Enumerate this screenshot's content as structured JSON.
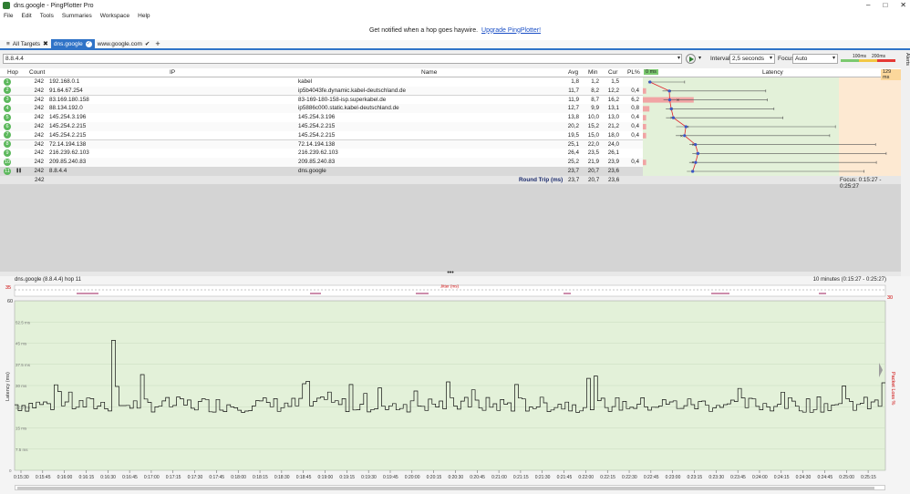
{
  "window": {
    "title": "dns.google - PingPlotter Pro"
  },
  "menu": [
    "File",
    "Edit",
    "Tools",
    "Summaries",
    "Workspace",
    "Help"
  ],
  "notice": {
    "text": "Get notified when a hop goes haywire.",
    "link": "Upgrade PingPlotter!"
  },
  "tabs": [
    {
      "label": "All Targets",
      "active": false
    },
    {
      "label": "dns.google",
      "active": true
    },
    {
      "label": "www.google.com",
      "active": false
    }
  ],
  "toolbar": {
    "address": "8.8.4.4",
    "interval_label": "Interval",
    "interval_value": "2,5 seconds",
    "focus_label": "Focus",
    "focus_value": "Auto",
    "scale_100": "100ms",
    "scale_200": "200ms",
    "alerts_label": "Alerts"
  },
  "columns": {
    "hop": "Hop",
    "count": "Count",
    "ip": "IP",
    "name": "Name",
    "avg": "Avg",
    "min": "Min",
    "cur": "Cur",
    "pl": "PL%",
    "latency": "Latency",
    "lat_min": "0 ms",
    "lat_max": "129 ms"
  },
  "hops": [
    {
      "hop": "1",
      "count": "242",
      "ip": "192.168.0.1",
      "name": "kabel",
      "avg": "1,8",
      "min": "1,2",
      "cur": "1,5",
      "pl": "",
      "pl_value": 0
    },
    {
      "hop": "2",
      "count": "242",
      "ip": "91.64.67.254",
      "name": "ip5b4043fe.dynamic.kabel-deutschland.de",
      "avg": "11,7",
      "min": "8,2",
      "cur": "12,2",
      "pl": "0,4",
      "pl_value": 0.4
    },
    {
      "hop": "3",
      "count": "242",
      "ip": "83.169.180.158",
      "name": "83-169-180-158-isp.superkabel.de",
      "avg": "11,9",
      "min": "8,7",
      "cur": "16,2",
      "pl": "6,2",
      "pl_value": 6.2
    },
    {
      "hop": "4",
      "count": "242",
      "ip": "88.134.192.0",
      "name": "ip5886c000.static.kabel-deutschland.de",
      "avg": "12,7",
      "min": "9,9",
      "cur": "13,1",
      "pl": "0,8",
      "pl_value": 0.8
    },
    {
      "hop": "5",
      "count": "242",
      "ip": "145.254.3.196",
      "name": "145.254.3.196",
      "avg": "13,8",
      "min": "10,0",
      "cur": "13,0",
      "pl": "0,4",
      "pl_value": 0.4
    },
    {
      "hop": "6",
      "count": "242",
      "ip": "145.254.2.215",
      "name": "145.254.2.215",
      "avg": "20,2",
      "min": "15,2",
      "cur": "21,2",
      "pl": "0,4",
      "pl_value": 0.4
    },
    {
      "hop": "7",
      "count": "242",
      "ip": "145.254.2.215",
      "name": "145.254.2.215",
      "avg": "19,5",
      "min": "15,0",
      "cur": "18,0",
      "pl": "0,4",
      "pl_value": 0.4
    },
    {
      "hop": "8",
      "count": "242",
      "ip": "72.14.194.138",
      "name": "72.14.194.138",
      "avg": "25,1",
      "min": "22,0",
      "cur": "24,0",
      "pl": "",
      "pl_value": 0
    },
    {
      "hop": "9",
      "count": "242",
      "ip": "216.239.62.103",
      "name": "216.239.62.103",
      "avg": "26,4",
      "min": "23,5",
      "cur": "26,1",
      "pl": "",
      "pl_value": 0
    },
    {
      "hop": "10",
      "count": "242",
      "ip": "209.85.240.83",
      "name": "209.85.240.83",
      "avg": "25,2",
      "min": "21,9",
      "cur": "23,9",
      "pl": "0,4",
      "pl_value": 0.4
    },
    {
      "hop": "11",
      "count": "242",
      "ip": "8.8.4.4",
      "name": "dns.google",
      "avg": "23,7",
      "min": "20,7",
      "cur": "23,6",
      "pl": "",
      "pl_value": 0
    }
  ],
  "summary": {
    "count": "242",
    "label": "Round Trip (ms)",
    "avg": "23,7",
    "min": "20,7",
    "cur": "23,6",
    "focus": "Focus: 0:15:27 - 0:25:27"
  },
  "colors": {
    "accent": "#2f73c7",
    "hop_ok": "#5cb85c",
    "latency_bg": "#e3f1d9",
    "latency_high_bg": "#fde9d2",
    "trace": "#e0202a"
  },
  "timeline": {
    "target": "dns.google (8.8.4.4) hop 11",
    "range": "10 minutes (0:15:27 - 0:25:27)",
    "jitter_label": "Jitter (ms)",
    "jitter_max": "35",
    "loss_max": "30",
    "ylabel": "Latency (ms)",
    "y2label": "Packet Loss %",
    "y_top": "60",
    "y_ticks": [
      "52.5 ms",
      "45 ms",
      "37.5 ms",
      "30 ms",
      "22.5 ms",
      "15 ms",
      "7.5 ms",
      "0"
    ],
    "x_ticks": [
      "0:15:30",
      "0:15:45",
      "0:16:00",
      "0:16:15",
      "0:16:30",
      "0:16:45",
      "0:17:00",
      "0:17:15",
      "0:17:30",
      "0:17:45",
      "0:18:00",
      "0:18:15",
      "0:18:30",
      "0:18:45",
      "0:19:00",
      "0:19:15",
      "0:19:30",
      "0:19:45",
      "0:20:00",
      "0:20:15",
      "0:20:30",
      "0:20:45",
      "0:21:00",
      "0:21:15",
      "0:21:30",
      "0:21:45",
      "0:22:00",
      "0:22:15",
      "0:22:30",
      "0:22:45",
      "0:23:00",
      "0:23:15",
      "0:23:30",
      "0:23:45",
      "0:24:00",
      "0:24:15",
      "0:24:30",
      "0:24:45",
      "0:25:00",
      "0:25:15"
    ]
  }
}
